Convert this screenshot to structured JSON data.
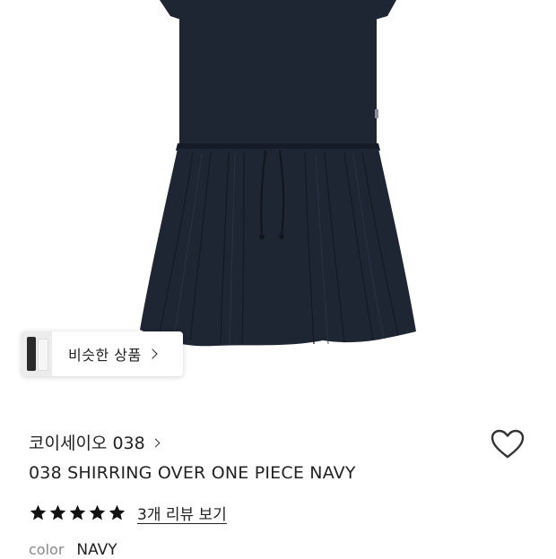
{
  "similar": {
    "label": "비슷한 상품"
  },
  "product": {
    "brand": "코이세이오 038",
    "title": "038 SHIRRING OVER ONE PIECE NAVY",
    "rating": 5,
    "review_link": "3개 리뷰 보기",
    "color_label": "color",
    "color_value": "NAVY"
  },
  "colors": {
    "dress": "#1f2633",
    "text": "#222222",
    "muted": "#888888"
  },
  "icons": {
    "wishlist": "heart-icon",
    "star": "star-icon",
    "chevron": "chevron-right-icon"
  }
}
